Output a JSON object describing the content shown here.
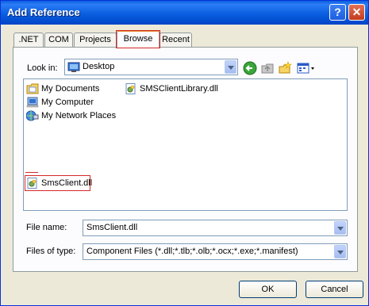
{
  "window": {
    "title": "Add Reference"
  },
  "title_buttons": {
    "help": "?",
    "close": "✕"
  },
  "tabs": [
    {
      "label": ".NET",
      "active": false
    },
    {
      "label": "COM",
      "active": false
    },
    {
      "label": "Projects",
      "active": false
    },
    {
      "label": "Browse",
      "active": true
    },
    {
      "label": "Recent",
      "active": false
    }
  ],
  "look_in": {
    "label": "Look in:",
    "value": "Desktop",
    "icon": "desktop-icon"
  },
  "toolbar": [
    "back-icon",
    "up-folder-icon",
    "new-folder-icon",
    "view-menu-icon"
  ],
  "files": [
    {
      "name": "My Documents",
      "icon": "my-documents-icon"
    },
    {
      "name": "My Computer",
      "icon": "my-computer-icon"
    },
    {
      "name": "My Network Places",
      "icon": "network-places-icon"
    },
    {
      "name": "SMSClientLibrary.dll",
      "icon": "dll-icon"
    },
    {
      "name": "SmsClient.dll",
      "icon": "dll-icon",
      "highlighted": true
    }
  ],
  "file_name": {
    "label": "File name:",
    "value": "SmsClient.dll"
  },
  "file_type": {
    "label": "Files of type:",
    "value": "Component Files (*.dll;*.tlb;*.olb;*.ocx;*.exe;*.manifest)"
  },
  "buttons": {
    "ok": "OK",
    "cancel": "Cancel"
  },
  "colors": {
    "titlebar": "#0a5fe0",
    "highlight": "#d42828",
    "dialog_bg": "#ece9d8"
  }
}
